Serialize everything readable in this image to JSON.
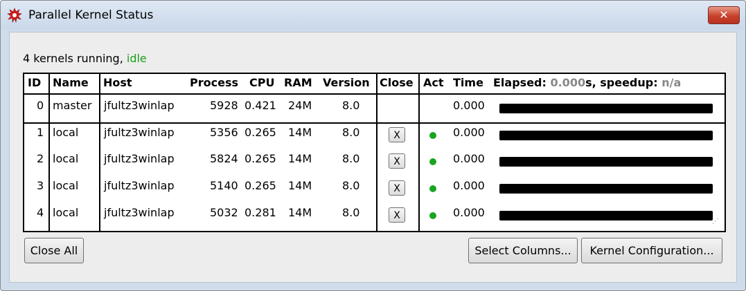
{
  "window": {
    "title": "Parallel Kernel Status",
    "close_glyph": "✕"
  },
  "status": {
    "prefix": "4 kernels running, ",
    "state": "idle"
  },
  "table": {
    "headers": {
      "id": "ID",
      "name": "Name",
      "host": "Host",
      "process": "Process",
      "cpu": "CPU",
      "ram": "RAM",
      "version": "Version",
      "close": "Close",
      "act": "Act",
      "time": "Time",
      "elapsed_label": "Elapsed: ",
      "elapsed_value": "0.000",
      "elapsed_unit": "s, speedup: ",
      "speedup_value": "n/a"
    },
    "rows": [
      {
        "id": "0",
        "name": "master",
        "host": "jfultz3winlap",
        "process": "5928",
        "cpu": "0.421",
        "ram": "24M",
        "version": "8.0",
        "close": "",
        "time": "0.000",
        "progress": 1
      },
      {
        "id": "1",
        "name": "local",
        "host": "jfultz3winlap",
        "process": "5356",
        "cpu": "0.265",
        "ram": "14M",
        "version": "8.0",
        "close": "X",
        "time": "0.000",
        "progress": 1
      },
      {
        "id": "2",
        "name": "local",
        "host": "jfultz3winlap",
        "process": "5824",
        "cpu": "0.265",
        "ram": "14M",
        "version": "8.0",
        "close": "X",
        "time": "0.000",
        "progress": 1
      },
      {
        "id": "3",
        "name": "local",
        "host": "jfultz3winlap",
        "process": "5140",
        "cpu": "0.265",
        "ram": "14M",
        "version": "8.0",
        "close": "X",
        "time": "0.000",
        "progress": 1
      },
      {
        "id": "4",
        "name": "local",
        "host": "jfultz3winlap",
        "process": "5032",
        "cpu": "0.281",
        "ram": "14M",
        "version": "8.0",
        "close": "X",
        "time": "0.000",
        "progress": 1
      }
    ]
  },
  "buttons": {
    "close_all": "Close All",
    "select_columns": "Select Columns...",
    "kernel_config": "Kernel Configuration..."
  },
  "colors": {
    "idle": "#1a9e1a",
    "active_dot": "#19a51f",
    "close_button": "#c7402c"
  },
  "icons": {
    "app": "gear-burst-icon",
    "active": "green-dot-icon",
    "resize": "resize-grip-icon"
  }
}
